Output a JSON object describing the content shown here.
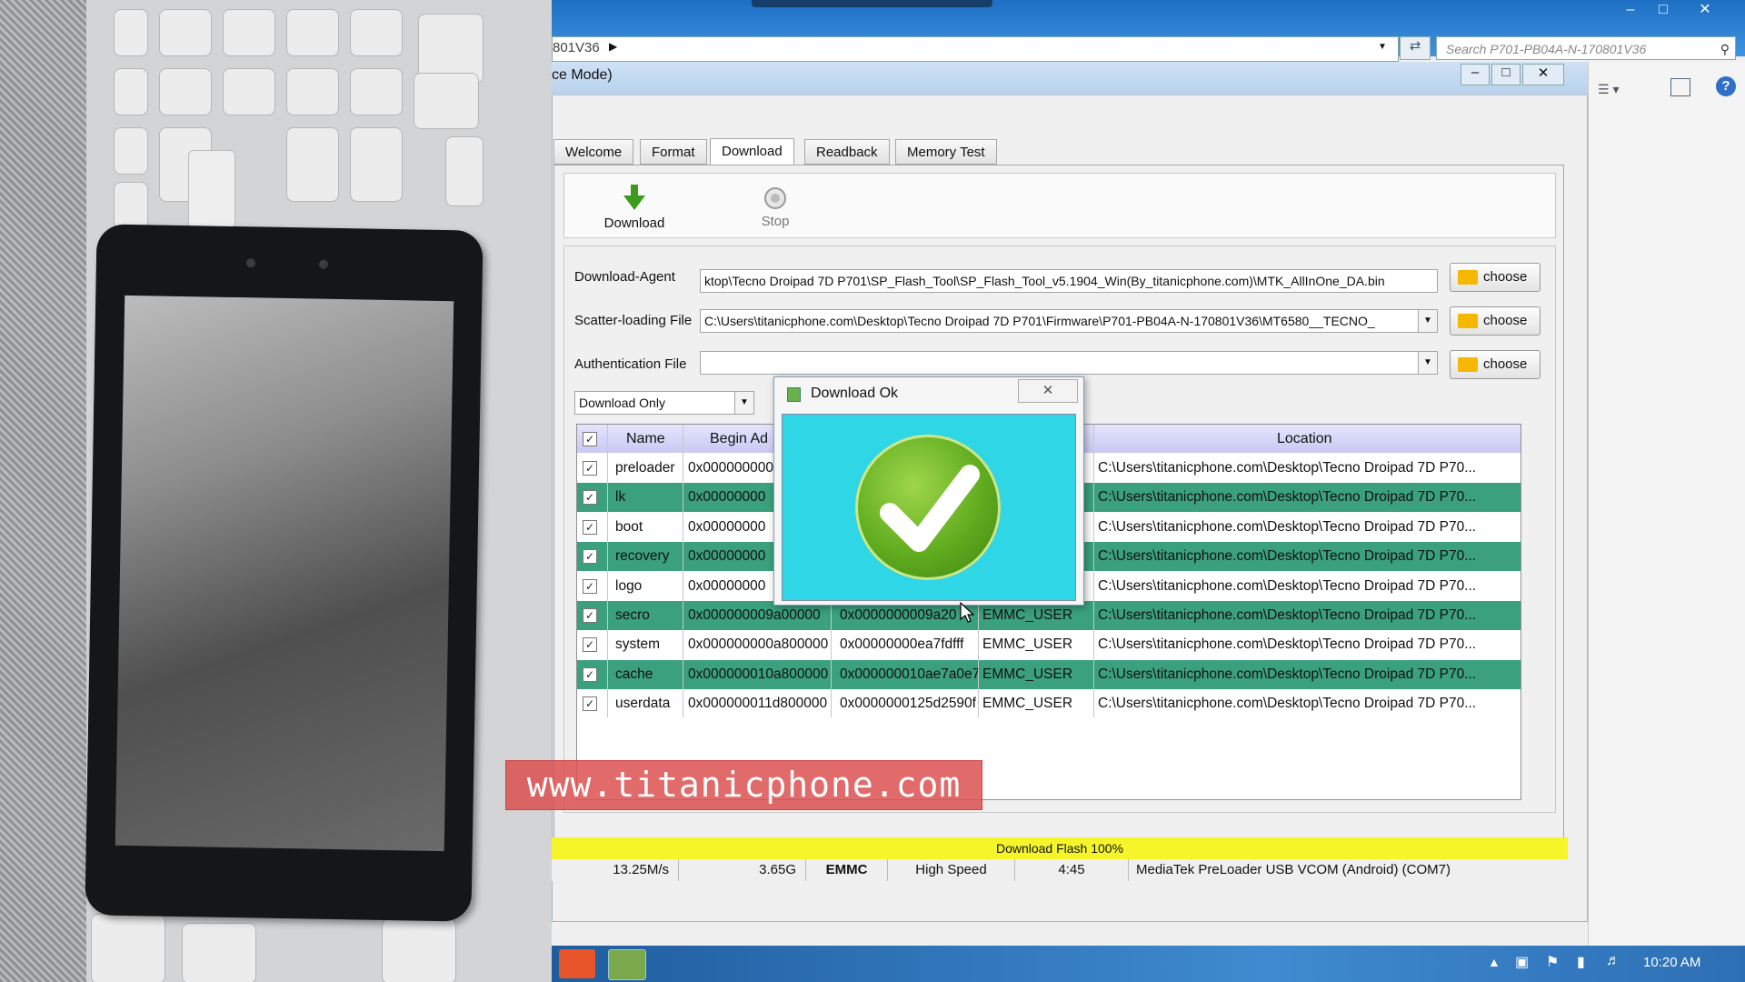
{
  "explorer": {
    "address_fragment": "801V36",
    "search_placeholder": "Search P701-PB04A-N-170801V36"
  },
  "app": {
    "title_fragment": "ce Mode)",
    "tabs": [
      "Welcome",
      "Format",
      "Download",
      "Readback",
      "Memory Test"
    ],
    "active_tab": "Download",
    "toolbar": {
      "download_label": "Download",
      "stop_label": "Stop"
    },
    "download_agent": {
      "label": "Download-Agent",
      "value": "ktop\\Tecno Droipad 7D P701\\SP_Flash_Tool\\SP_Flash_Tool_v5.1904_Win(By_titanicphone.com)\\MTK_AllInOne_DA.bin"
    },
    "scatter_file": {
      "label": "Scatter-loading File",
      "value": "C:\\Users\\titanicphone.com\\Desktop\\Tecno Droipad 7D P701\\Firmware\\P701-PB04A-N-170801V36\\MT6580__TECNO_"
    },
    "auth_file": {
      "label": "Authentication File",
      "value": ""
    },
    "choose_label": "choose",
    "mode_select": "Download Only",
    "table": {
      "headers": [
        "Name",
        "Begin Ad",
        "Location"
      ],
      "rows": [
        {
          "name": "preloader",
          "begin": "0x000000000",
          "end": "",
          "region": "",
          "location": "C:\\Users\\titanicphone.com\\Desktop\\Tecno Droipad 7D P70...",
          "green": false
        },
        {
          "name": "lk",
          "begin": "0x00000000",
          "end": "",
          "region": "",
          "location": "C:\\Users\\titanicphone.com\\Desktop\\Tecno Droipad 7D P70...",
          "green": true
        },
        {
          "name": "boot",
          "begin": "0x00000000",
          "end": "",
          "region": "",
          "location": "C:\\Users\\titanicphone.com\\Desktop\\Tecno Droipad 7D P70...",
          "green": false
        },
        {
          "name": "recovery",
          "begin": "0x00000000",
          "end": "",
          "region": "",
          "location": "C:\\Users\\titanicphone.com\\Desktop\\Tecno Droipad 7D P70...",
          "green": true
        },
        {
          "name": "logo",
          "begin": "0x00000000",
          "end": "",
          "region": "",
          "location": "C:\\Users\\titanicphone.com\\Desktop\\Tecno Droipad 7D P70...",
          "green": false
        },
        {
          "name": "secro",
          "begin": "0x000000009a00000",
          "end": "0x0000000009a20",
          "region": "EMMC_USER",
          "location": "C:\\Users\\titanicphone.com\\Desktop\\Tecno Droipad 7D P70...",
          "green": true
        },
        {
          "name": "system",
          "begin": "0x000000000a800000",
          "end": "0x00000000ea7fdfff",
          "region": "EMMC_USER",
          "location": "C:\\Users\\titanicphone.com\\Desktop\\Tecno Droipad 7D P70...",
          "green": false
        },
        {
          "name": "cache",
          "begin": "0x000000010a800000",
          "end": "0x000000010ae7a0e7",
          "region": "EMMC_USER",
          "location": "C:\\Users\\titanicphone.com\\Desktop\\Tecno Droipad 7D P70...",
          "green": true
        },
        {
          "name": "userdata",
          "begin": "0x000000011d800000",
          "end": "0x0000000125d2590f",
          "region": "EMMC_USER",
          "location": "C:\\Users\\titanicphone.com\\Desktop\\Tecno Droipad 7D P70...",
          "green": false
        }
      ]
    },
    "progress": {
      "text": "Download Flash 100%",
      "percent": 100
    },
    "status": {
      "speed": "13.25M/s",
      "size": "3.65G",
      "storage": "EMMC",
      "usb_speed": "High Speed",
      "time": "4:45",
      "port": "MediaTek PreLoader USB VCOM (Android) (COM7)"
    }
  },
  "dialog": {
    "title": "Download Ok"
  },
  "watermark": "www.titanicphone.com",
  "taskbar": {
    "clock": "10:20 AM"
  },
  "colors": {
    "row_green": "#3aa07d",
    "progress_yellow": "#f5f52a",
    "dialog_cyan": "#2fd6e6"
  }
}
